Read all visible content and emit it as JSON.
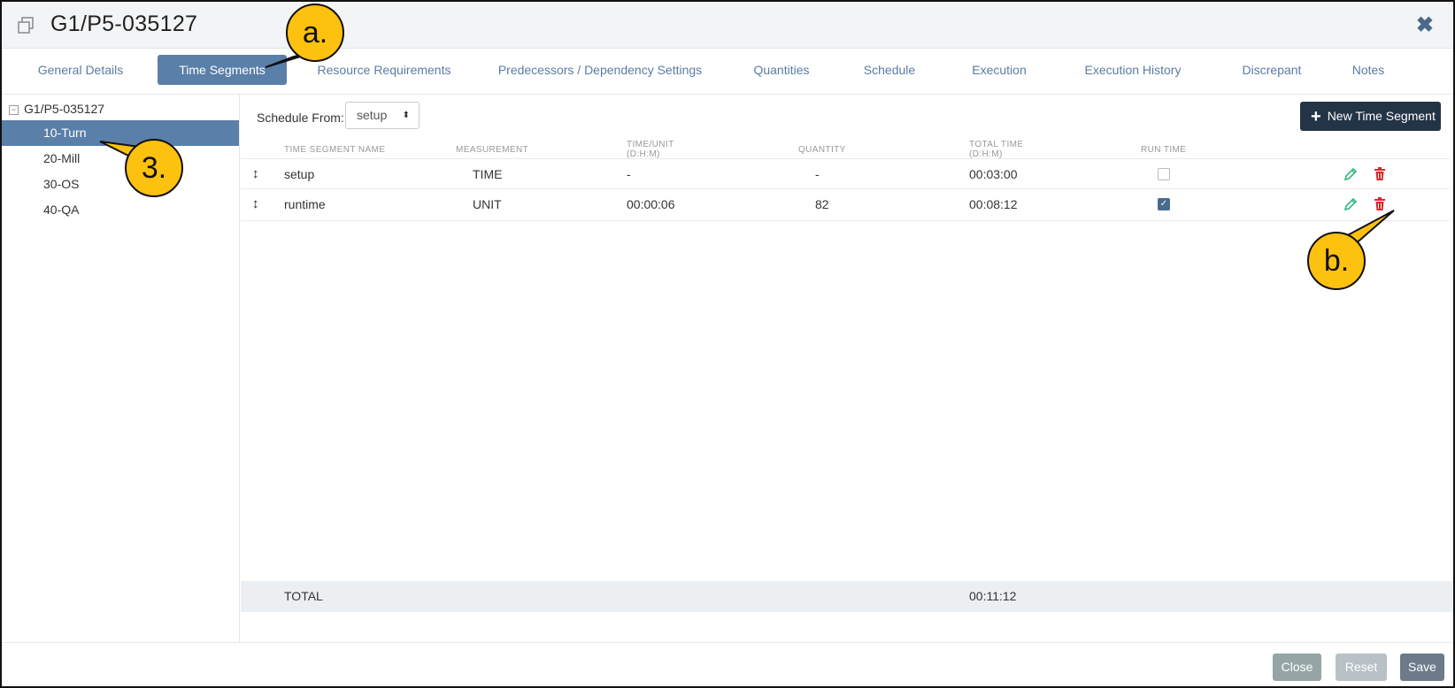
{
  "header": {
    "title": "G1/P5-035127",
    "window_icon": "copy-window-icon",
    "close_icon": "close-x-icon"
  },
  "tabs": [
    {
      "label": "General Details",
      "active": false
    },
    {
      "label": "Time Segments",
      "active": true
    },
    {
      "label": "Resource Requirements",
      "active": false
    },
    {
      "label": "Predecessors / Dependency Settings",
      "active": false
    },
    {
      "label": "Quantities",
      "active": false
    },
    {
      "label": "Schedule",
      "active": false
    },
    {
      "label": "Execution",
      "active": false
    },
    {
      "label": "Execution History",
      "active": false
    },
    {
      "label": "Discrepant",
      "active": false
    },
    {
      "label": "Notes",
      "active": false
    }
  ],
  "sidebar": {
    "root_label": "G1/P5-035127",
    "root_toggle": "−",
    "items": [
      {
        "label": "10-Turn",
        "active": true
      },
      {
        "label": "20-Mill",
        "active": false
      },
      {
        "label": "30-OS",
        "active": false
      },
      {
        "label": "40-QA",
        "active": false
      }
    ]
  },
  "main": {
    "schedule_from_label": "Schedule From:",
    "schedule_from_value": "setup",
    "new_button_label": "New Time Segment",
    "columns": {
      "name": "TIME SEGMENT NAME",
      "measurement": "MEASUREMENT",
      "time_unit": "TIME/UNIT",
      "time_unit_sub": "(D:H:M)",
      "quantity": "QUANTITY",
      "total_time": "TOTAL TIME",
      "total_time_sub": "(D:H:M)",
      "run_time": "RUN TIME"
    },
    "rows": [
      {
        "name": "setup",
        "measurement": "TIME",
        "time_unit": "-",
        "quantity": "-",
        "total_time": "00:03:00",
        "run_time": false
      },
      {
        "name": "runtime",
        "measurement": "UNIT",
        "time_unit": "00:00:06",
        "quantity": "82",
        "total_time": "00:08:12",
        "run_time": true
      }
    ],
    "total_label": "TOTAL",
    "total_value": "00:11:12"
  },
  "footer": {
    "close_label": "Close",
    "reset_label": "Reset",
    "save_label": "Save"
  },
  "callouts": {
    "a": "a.",
    "b": "b.",
    "c": "3."
  },
  "colors": {
    "accent": "#5a7fa8",
    "dark_button": "#243447",
    "callout": "#fdc10f",
    "edit": "#2fb67c",
    "delete": "#e0242a"
  }
}
